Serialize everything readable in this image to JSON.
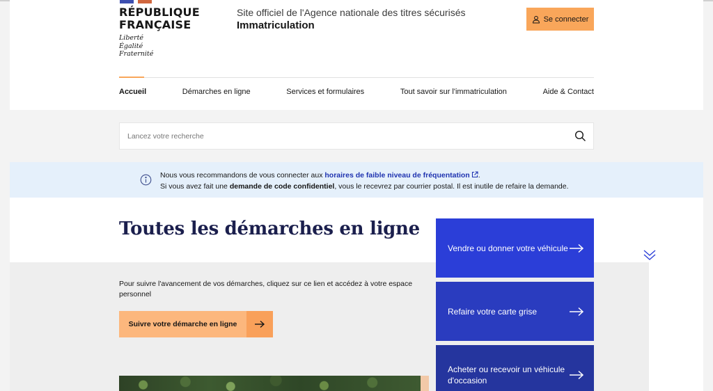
{
  "header": {
    "brand_line1": "RÉPUBLIQUE",
    "brand_line2": "FRANÇAISE",
    "motto_1": "Liberté",
    "motto_2": "Égalité",
    "motto_3": "Fraternité",
    "site_description": "Site officiel de l'Agence nationale des titres sécurisés",
    "site_title": "Immatriculation",
    "login_label": "Se connecter",
    "login_icon": "user-icon"
  },
  "nav": {
    "items": [
      {
        "label": "Accueil",
        "active": true
      },
      {
        "label": "Démarches en ligne",
        "active": false
      },
      {
        "label": "Services et formulaires",
        "active": false
      },
      {
        "label": "Tout savoir sur l'immatriculation",
        "active": false
      },
      {
        "label": "Aide & Contact",
        "active": false
      }
    ]
  },
  "search": {
    "placeholder": "Lancez votre recherche",
    "icon": "search-icon"
  },
  "info": {
    "line1_before": "Nous vous recommandons de vous connecter aux ",
    "line1_link": "horaires de faible niveau de fréquentation",
    "line1_after": ".",
    "line2_before": "Si vous avez fait une ",
    "line2_bold": "demande de code confidentiel",
    "line2_after": ", vous le recevrez par courrier postal. Il est inutile de refaire la demande."
  },
  "main": {
    "title": "Toutes les démarches en ligne",
    "tracking_text": "Pour suivre l'avancement de vos démarches, cliquez sur ce lien et accédez à votre espace personnel",
    "tracking_button": "Suivre votre démarche en ligne"
  },
  "cards": [
    {
      "label": "Vendre ou donner votre véhicule"
    },
    {
      "label": "Refaire votre carte grise"
    },
    {
      "label": "Acheter ou recevoir un véhicule d'occasion"
    }
  ],
  "colors": {
    "accent_orange": "#f9a65a",
    "link_blue": "#1f33b0",
    "card_blue": "#2b3ed8",
    "title_navy": "#1b1f4d",
    "info_bg": "#e5f0fb"
  }
}
